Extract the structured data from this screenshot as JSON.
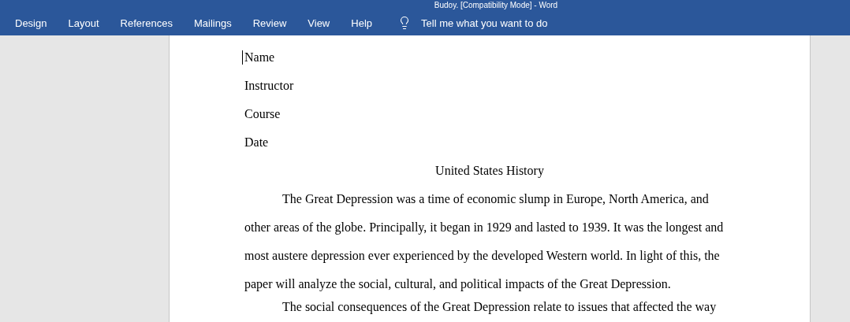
{
  "window": {
    "title": "Budoy. [Compatibility Mode] - Word"
  },
  "ribbon_tabs": [
    {
      "label": "Design"
    },
    {
      "label": "Layout"
    },
    {
      "label": "References"
    },
    {
      "label": "Mailings"
    },
    {
      "label": "Review"
    },
    {
      "label": "View"
    },
    {
      "label": "Help"
    }
  ],
  "tell_me": {
    "placeholder": "Tell me what you want to do"
  },
  "document": {
    "header_lines": [
      "Name",
      "Instructor",
      "Course",
      "Date"
    ],
    "title": "United States History",
    "paragraphs": [
      "The Great Depression was a time of economic slump in Europe, North America, and other areas of the globe. Principally, it began in 1929 and lasted to 1939. It was the longest and most austere depression ever experienced by the developed Western world. In light of this, the paper will analyze the social, cultural, and political impacts of the Great Depression.",
      "The social consequences of the Great Depression relate to issues that affected the way"
    ]
  }
}
